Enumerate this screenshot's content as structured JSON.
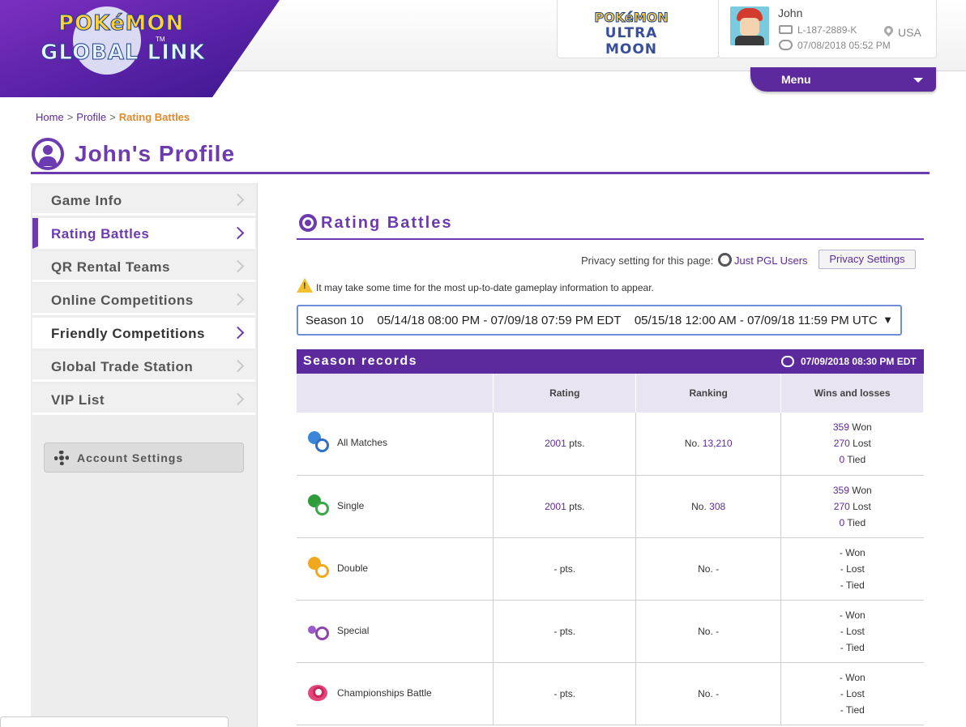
{
  "header": {
    "logo_top": "POKéMON",
    "logo_bottom": "GLOBAL LINK",
    "logo_tm": "TM",
    "game_logo": {
      "line1": "POKéMON",
      "line2": "ULTRA MOON"
    },
    "user": {
      "name": "John",
      "id": "L-187-2889-K",
      "datetime": "07/08/2018 05:52 PM",
      "country": "USA"
    },
    "menu_label": "Menu"
  },
  "breadcrumb": {
    "home": "Home",
    "sep1": ">",
    "profile": "Profile",
    "sep2": ">",
    "current": "Rating Battles"
  },
  "page_title": "John's Profile",
  "sidebar": {
    "items": [
      {
        "label": "Game Info"
      },
      {
        "label": "Rating Battles"
      },
      {
        "label": "QR Rental Teams"
      },
      {
        "label": "Online Competitions"
      },
      {
        "label": "Friendly Competitions"
      },
      {
        "label": "Global Trade Station"
      },
      {
        "label": "VIP List"
      }
    ],
    "account_settings": "Account Settings"
  },
  "main": {
    "section_title": "Rating Battles",
    "privacy_label": "Privacy setting for this page:",
    "privacy_value": "Just PGL Users",
    "privacy_button": "Privacy Settings",
    "warning": "It may take some time for the most up-to-date gameplay information to appear.",
    "season_select": "Season 10    05/14/18 08:00 PM - 07/09/18 07:59 PM EDT    05/15/18 12:00 AM - 07/09/18 11:59 PM UTC",
    "records_title": "Season records",
    "records_time": "07/09/2018 08:30 PM  EDT",
    "columns": [
      "",
      "Rating",
      "Ranking",
      "Wins and losses"
    ],
    "rows": [
      {
        "name": "All Matches",
        "rating": "2001",
        "pts": " pts.",
        "no": "No. ",
        "rank": "13,210",
        "won": "359",
        "lost": "270",
        "tied": "0",
        "won_l": " Won",
        "lost_l": " Lost",
        "tied_l": " Tied"
      },
      {
        "name": "Single",
        "rating": "2001",
        "pts": " pts.",
        "no": "No. ",
        "rank": "308",
        "won": "359",
        "lost": "270",
        "tied": "0",
        "won_l": " Won",
        "lost_l": " Lost",
        "tied_l": " Tied"
      },
      {
        "name": "Double",
        "rating": "-",
        "pts": " pts.",
        "no": "No. ",
        "rank": "-",
        "won": "-",
        "lost": "-",
        "tied": "-",
        "won_l": " Won",
        "lost_l": " Lost",
        "tied_l": " Tied"
      },
      {
        "name": "Special",
        "rating": "-",
        "pts": " pts.",
        "no": "No. ",
        "rank": "-",
        "won": "-",
        "lost": "-",
        "tied": "-",
        "won_l": " Won",
        "lost_l": " Lost",
        "tied_l": " Tied"
      },
      {
        "name": "Championships Battle",
        "rating": "-",
        "pts": " pts.",
        "no": "No. ",
        "rank": "-",
        "won": "-",
        "lost": "-",
        "tied": "-",
        "won_l": " Won",
        "lost_l": " Lost",
        "tied_l": " Tied"
      }
    ],
    "row_icons": [
      "globe-icon",
      "single-battle-icon",
      "double-battle-icon",
      "special-battle-icon",
      "championship-icon"
    ]
  },
  "colors": {
    "brand_purple": "#5c2a9d",
    "accent_orange": "#e08a2c"
  }
}
